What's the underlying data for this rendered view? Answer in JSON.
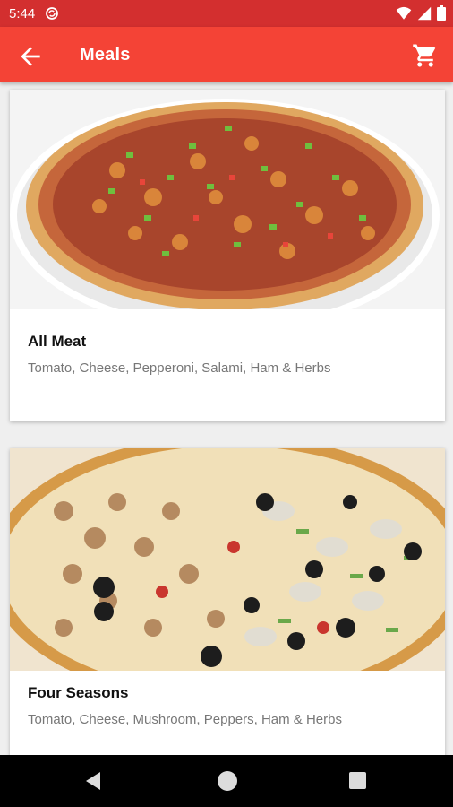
{
  "status_bar": {
    "time": "5:44",
    "icons": [
      "sync-icon",
      "wifi-icon",
      "cellular-icon",
      "battery-icon"
    ]
  },
  "app_bar": {
    "title": "Meals",
    "back_icon": "arrow-back-icon",
    "cart_icon": "shopping-cart-icon",
    "color": "#f44336"
  },
  "meals": [
    {
      "name": "All Meat",
      "description": "Tomato, Cheese, Pepperoni, Salami, Ham & Herbs",
      "image": "pizza-photo"
    },
    {
      "name": "Four Seasons",
      "description": "Tomato, Cheese, Mushroom, Peppers, Ham & Herbs",
      "image": "pizza-photo"
    }
  ],
  "nav_bar": {
    "icons": [
      "nav-back-icon",
      "nav-home-icon",
      "nav-recents-icon"
    ]
  },
  "colors": {
    "primary": "#f44336",
    "status": "#d32f2f",
    "background": "#efefef"
  }
}
